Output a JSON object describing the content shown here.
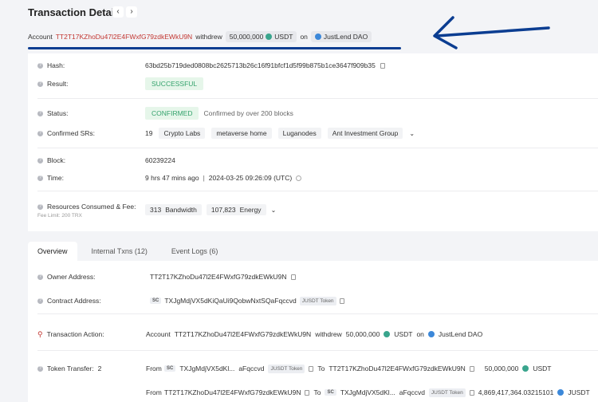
{
  "header": {
    "title": "Transaction Details",
    "prev": "‹",
    "next": "›"
  },
  "summary": {
    "account_label": "Account",
    "account": "TT2T17KZhoDu47l2E4FWxfG79zdkEWkU9N",
    "action": "withdrew",
    "amount": "50,000,000",
    "token": "USDT",
    "on": "on",
    "platform": "JustLend DAO"
  },
  "details": {
    "hash_label": "Hash:",
    "hash": "63bd25b719ded0808bc2625713b26c16f91bfcf1d5f99b875b1ce3647f909b35",
    "result_label": "Result:",
    "result": "SUCCESSFUL",
    "status_label": "Status:",
    "status": "CONFIRMED",
    "status_note": "Confirmed by over 200 blocks",
    "srs_label": "Confirmed SRs:",
    "srs_count": "19",
    "srs": [
      "Crypto Labs",
      "metaverse home",
      "Luganodes",
      "Ant Investment Group"
    ],
    "block_label": "Block:",
    "block": "60239224",
    "time_label": "Time:",
    "time_ago": "9 hrs 47 mins ago",
    "time_sep": "|",
    "time_abs": "2024-03-25 09:26:09 (UTC)",
    "resources_label": "Resources Consumed & Fee:",
    "fee_limit": "Fee Limit: 200 TRX",
    "bandwidth_val": "313",
    "bandwidth_label": "Bandwidth",
    "energy_val": "107,823",
    "energy_label": "Energy"
  },
  "tabs": [
    "Overview",
    "Internal Txns (12)",
    "Event Logs (6)"
  ],
  "overview": {
    "owner_label": "Owner Address:",
    "owner": "TT2T17KZhoDu47l2E4FWxfG79zdkEWkU9N",
    "contract_label": "Contract Address:",
    "sc": "SC",
    "contract": "TXJgMdjVX5dKiQaUi9QobwNxtSQaFqccvd",
    "contract_tag": "JUSDT Token",
    "action_label": "Transaction Action:",
    "action_account": "Account",
    "action_addr": "TT2T17KZhoDu47l2E4FWxfG79zdkEWkU9N",
    "action_verb": "withdrew",
    "action_amount": "50,000,000",
    "action_token": "USDT",
    "action_on": "on",
    "action_platform": "JustLend DAO",
    "transfer_label": "Token Transfer:",
    "transfer_count": "2",
    "t1_from": "From",
    "t1_from_addr1": "TXJgMdjVX5dKl...",
    "t1_from_addr2": "aFqccvd",
    "t1_tag": "JUSDT Token",
    "t1_to": "To",
    "t1_to_addr": "TT2T17KZhoDu47l2E4FWxfG79zdkEWkU9N",
    "t1_amount": "50,000,000",
    "t1_token": "USDT",
    "t2_from": "From",
    "t2_from_addr": "TT2T17KZhoDu47l2E4FWxfG79zdkEWkU9N",
    "t2_to": "To",
    "t2_to_addr1": "TXJgMdjVX5dKl...",
    "t2_to_addr2": "aFqccvd",
    "t2_tag": "JUSDT Token",
    "t2_amount": "4,869,417,364.03215101",
    "t2_token": "JUSDT"
  },
  "colors": {
    "address_red": "#c23631",
    "annotation_blue": "#0b3d91",
    "success_green": "#35a36d"
  }
}
